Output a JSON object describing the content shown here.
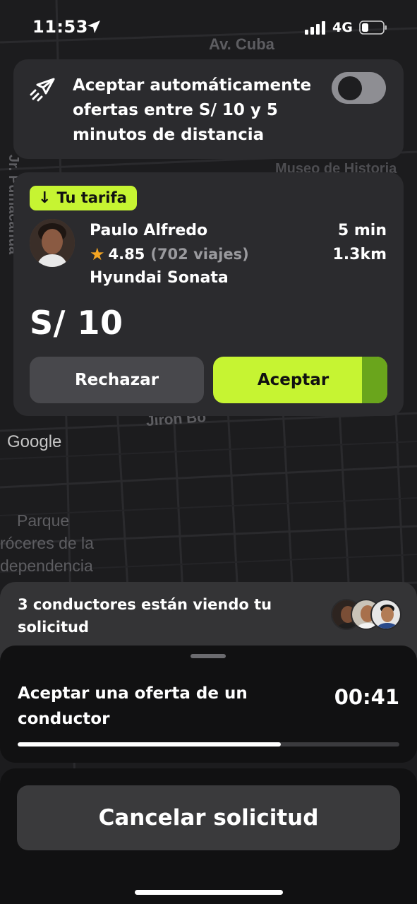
{
  "status_bar": {
    "time": "11:53",
    "network": "4G"
  },
  "map": {
    "labels": {
      "av_cuba": "Av. Cuba",
      "jr_pumacahua": "Jr. Pumacahua",
      "museo": "Museo de Historia",
      "jiron": "Jirón Bo",
      "parque_1": "Parque",
      "parque_2": "róceres de la",
      "parque_3": "dependencia"
    },
    "google": "Google"
  },
  "auto_accept": {
    "text": "Aceptar automáticamente ofertas entre S/ 10 y 5 minutos de distancia",
    "icon": "paper-plane-icon",
    "enabled": false
  },
  "offer": {
    "badge": "Tu tarifa",
    "badge_icon": "arrow-down-icon",
    "driver_name": "Paulo Alfredo",
    "rating": "4.85",
    "trips": "(702 viajes)",
    "car": "Hyundai Sonata",
    "eta": "5 min",
    "distance": "1.3km",
    "fare": "S/ 10",
    "reject_label": "Rechazar",
    "accept_label": "Aceptar",
    "accent_color": "#c6f432"
  },
  "viewers": {
    "text": "3 conductores están viendo tu solicitud",
    "count": 3
  },
  "sheet": {
    "title": "Aceptar una oferta de un conductor",
    "countdown": "00:41",
    "progress": 0.69
  },
  "cancel_label": "Cancelar solicitud"
}
